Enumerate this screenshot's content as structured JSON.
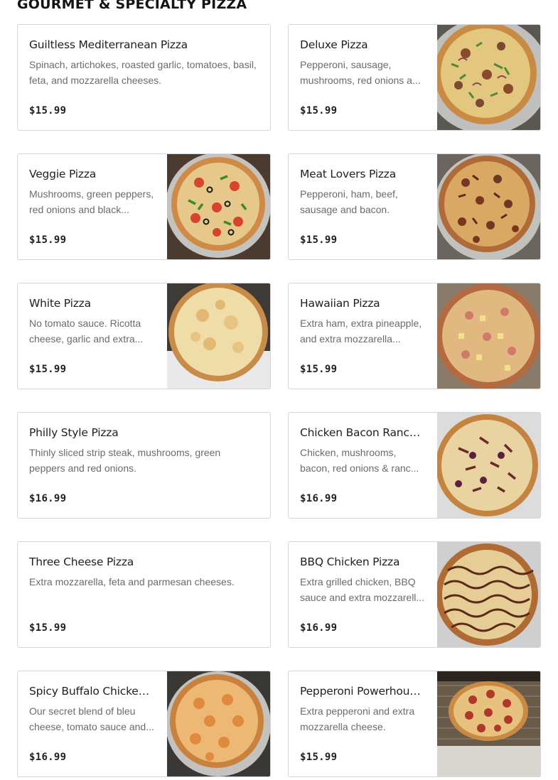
{
  "section": {
    "title": "GOURMET & SPECIALTY PIZZA"
  },
  "items": [
    {
      "name": "Guiltless Mediterranean Pizza",
      "description": "Spinach, artichokes, roasted garlic, tomatoes, basil, feta, and mozzarella cheeses.",
      "price": "$15.99",
      "image": "none"
    },
    {
      "name": "Deluxe Pizza",
      "description": "Pepperoni, sausage, mushrooms, red onions a...",
      "price": "$15.99",
      "image": "pizza-photo-deluxe"
    },
    {
      "name": "Veggie Pizza",
      "description": "Mushrooms, green peppers, red onions and black...",
      "price": "$15.99",
      "image": "pizza-photo-veggie"
    },
    {
      "name": "Meat Lovers Pizza",
      "description": "Pepperoni, ham, beef, sausage and bacon.",
      "price": "$15.99",
      "image": "pizza-photo-meat-lovers"
    },
    {
      "name": "White Pizza",
      "description": "No tomato sauce. Ricotta cheese, garlic and extra...",
      "price": "$15.99",
      "image": "pizza-photo-white"
    },
    {
      "name": "Hawaiian Pizza",
      "description": "Extra ham, extra pineapple, and extra mozzarella...",
      "price": "$15.99",
      "image": "pizza-photo-hawaiian"
    },
    {
      "name": "Philly Style Pizza",
      "description": "Thinly sliced strip steak, mushrooms, green peppers and red onions.",
      "price": "$16.99",
      "image": "none"
    },
    {
      "name": "Chicken Bacon Ranch...",
      "description": "Chicken, mushrooms, bacon, red onions & ranc...",
      "price": "$16.99",
      "image": "pizza-photo-chicken-bacon-ranch"
    },
    {
      "name": "Three Cheese Pizza",
      "description": "Extra mozzarella, feta and parmesan cheeses.",
      "price": "$15.99",
      "image": "none"
    },
    {
      "name": "BBQ Chicken Pizza",
      "description": "Extra grilled chicken, BBQ sauce and extra mozzarell...",
      "price": "$16.99",
      "image": "pizza-photo-bbq-chicken"
    },
    {
      "name": "Spicy Buffalo Chicken...",
      "description": "Our secret blend of bleu cheese, tomato sauce and...",
      "price": "$16.99",
      "image": "pizza-photo-buffalo-chicken"
    },
    {
      "name": "Pepperoni Powerhous...",
      "description": "Extra pepperoni and extra mozzarella cheese.",
      "price": "$15.99",
      "image": "pizza-photo-pepperoni"
    }
  ]
}
